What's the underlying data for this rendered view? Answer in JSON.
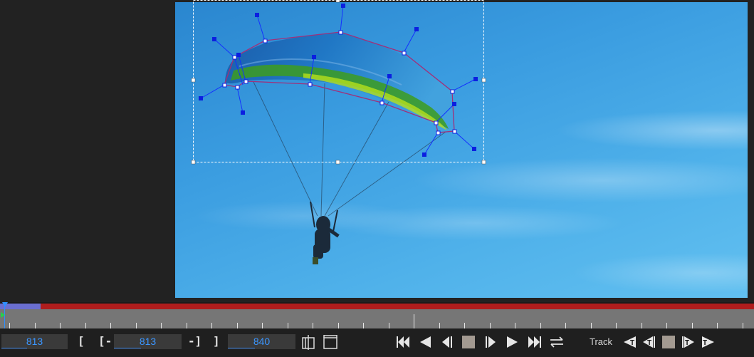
{
  "viewer": {
    "frame_name": "video-frame",
    "spline_points": 14,
    "tangent_handles": 14
  },
  "timeline": {
    "progress_fraction": 0.054,
    "current_frame_marker": "playhead"
  },
  "controls": {
    "current_frame": "813",
    "in_point": "813",
    "out_point": "840",
    "bracket_open": "[",
    "bracket_in_open": "[-",
    "bracket_in_close": "-]",
    "bracket_close": "]",
    "track_label": "Track"
  },
  "icons": {
    "set_in": "clip-in-icon",
    "set_range": "clip-range-icon",
    "first": "skip-to-start-icon",
    "prev": "play-backward-icon",
    "step_back": "step-backward-icon",
    "stop": "stop-icon",
    "step_fwd": "step-forward-icon",
    "next": "play-forward-icon",
    "last": "skip-to-end-icon",
    "loop": "loop-icon",
    "track_back": "track-backward-icon",
    "track_step_back": "track-step-backward-icon",
    "track_stop": "track-stop-icon",
    "track_step_fwd": "track-step-forward-icon",
    "track_fwd": "track-forward-icon"
  },
  "colors": {
    "accent": "#3b96ff",
    "range_bar": "#b01d1d",
    "range_done": "#6b6fd0",
    "spline": "#a0307a",
    "handle": "#0b1fe0"
  }
}
